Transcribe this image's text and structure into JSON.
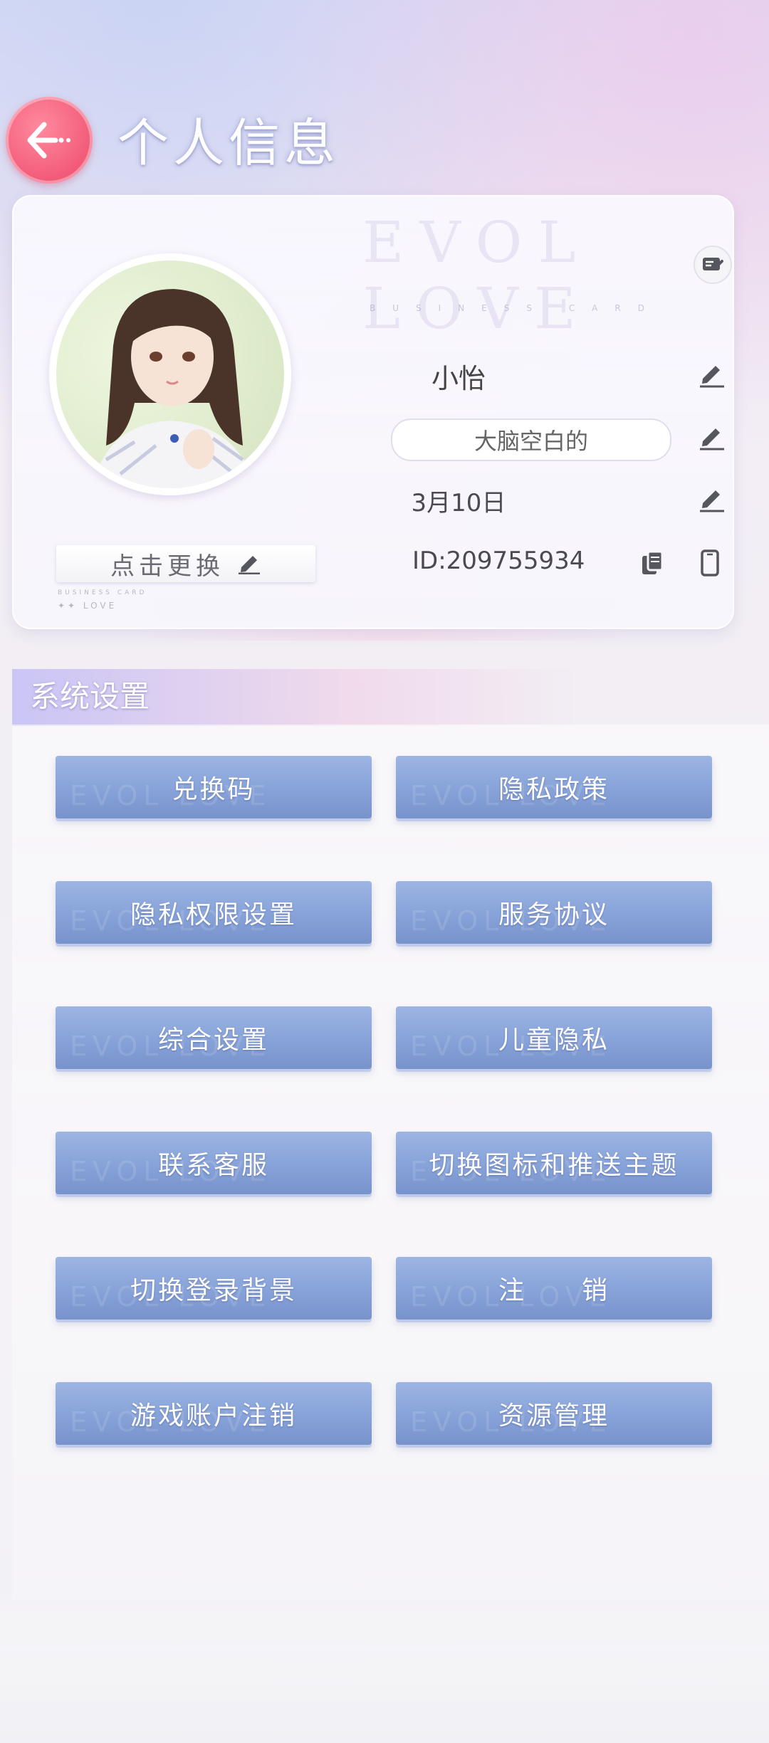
{
  "header": {
    "title": "个人信息"
  },
  "profile": {
    "watermark": "EVOL LOVE",
    "card_sub": "BUSINESS CARD",
    "name": "小怡",
    "signature": "大脑空白的",
    "birthday": "3月10日",
    "id": "ID:209755934",
    "change_avatar_label": "点击更换",
    "mini_business": "BUSINESS CARD",
    "mini_love": "✦✦ LOVE"
  },
  "settings": {
    "title": "系统设置",
    "buttons": [
      "兑换码",
      "隐私政策",
      "隐私权限设置",
      "服务协议",
      "综合设置",
      "儿童隐私",
      "联系客服",
      "切换图标和推送主题",
      "切换登录背景",
      "注　　销",
      "游戏账户注销",
      "资源管理"
    ]
  },
  "colors": {
    "accent": "#f25a78",
    "button": "#86a2d8"
  }
}
